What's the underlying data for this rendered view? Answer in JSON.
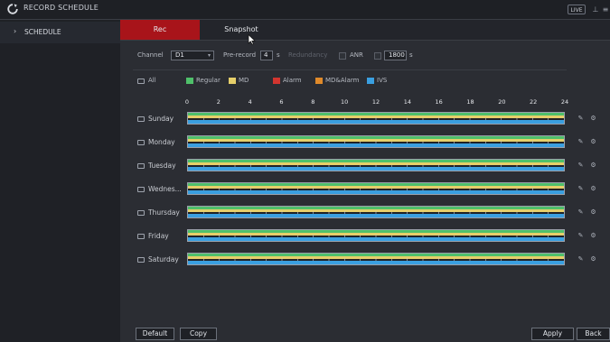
{
  "titlebar": {
    "title": "RECORD SCHEDULE",
    "live_label": "LIVE"
  },
  "sidebar": {
    "items": [
      {
        "label": "SCHEDULE"
      }
    ]
  },
  "tabs": [
    {
      "label": "Rec",
      "active": true
    },
    {
      "label": "Snapshot",
      "active": false
    }
  ],
  "controls": {
    "channel_label": "Channel",
    "channel_value": "D1",
    "prerecord_label": "Pre-record",
    "prerecord_value": "4",
    "prerecord_unit": "s",
    "redundancy_label": "Redundancy",
    "anr_label": "ANR",
    "anr_value": "1800",
    "anr_unit": "s"
  },
  "legend": {
    "all_label": "All",
    "items": [
      {
        "label": "Regular",
        "color": "#4fc06a"
      },
      {
        "label": "MD",
        "color": "#e6cf6a"
      },
      {
        "label": "Alarm",
        "color": "#d2352f"
      },
      {
        "label": "MD&Alarm",
        "color": "#e08a2a"
      },
      {
        "label": "IVS",
        "color": "#3a9fe0"
      }
    ]
  },
  "timeline": {
    "hours": [
      "0",
      "2",
      "4",
      "6",
      "8",
      "10",
      "12",
      "14",
      "16",
      "18",
      "20",
      "22",
      "24"
    ]
  },
  "days": [
    {
      "label": "Sunday"
    },
    {
      "label": "Monday"
    },
    {
      "label": "Tuesday"
    },
    {
      "label": "Wednes..."
    },
    {
      "label": "Thursday"
    },
    {
      "label": "Friday"
    },
    {
      "label": "Saturday"
    }
  ],
  "footer": {
    "default_label": "Default",
    "copy_label": "Copy",
    "apply_label": "Apply",
    "back_label": "Back"
  }
}
